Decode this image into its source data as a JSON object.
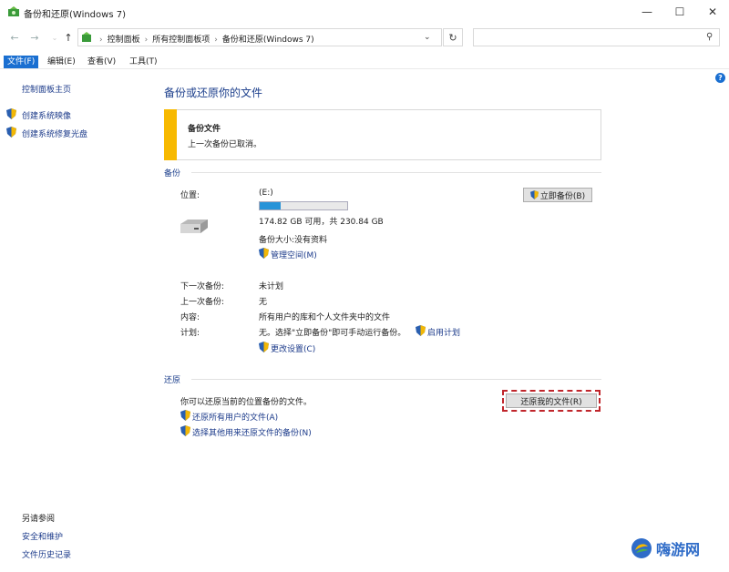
{
  "window": {
    "title": "备份和还原(Windows 7)",
    "controls": {
      "minimize": "—",
      "maximize": "☐",
      "close": "✕"
    }
  },
  "nav": {
    "back": "←",
    "forward": "→",
    "up": "↑",
    "breadcrumbs": [
      "控制面板",
      "所有控制面板项",
      "备份和还原(Windows 7)"
    ],
    "search_placeholder": ""
  },
  "menu": {
    "items": [
      "文件(F)",
      "编辑(E)",
      "查看(V)",
      "工具(T)"
    ],
    "help": "?"
  },
  "sidebar": {
    "home": "控制面板主页",
    "items": [
      "创建系统映像",
      "创建系统修复光盘"
    ],
    "see_also": {
      "title": "另请参阅",
      "items": [
        "安全和维护",
        "文件历史记录"
      ]
    }
  },
  "main": {
    "heading": "备份或还原你的文件",
    "notice": {
      "title": "备份文件",
      "text": "上一次备份已取消。",
      "accent": "#f7b900"
    },
    "backup": {
      "section": "备份",
      "location_label": "位置:",
      "drive_label": "(E:)",
      "used_fraction": 0.24,
      "space": "174.82 GB 可用，共 230.84 GB",
      "size_text": "备份大小:没有资料",
      "manage_space": "管理空间(M)",
      "backup_now": "立即备份(B)",
      "rows": [
        {
          "label": "下一次备份:",
          "value": "未计划"
        },
        {
          "label": "上一次备份:",
          "value": "无"
        },
        {
          "label": "内容:",
          "value": "所有用户的库和个人文件夹中的文件"
        },
        {
          "label": "计划:",
          "value": "无。选择\"立即备份\"即可手动运行备份。"
        }
      ],
      "enable_schedule": "启用计划",
      "change_settings": "更改设置(C)"
    },
    "restore": {
      "section": "还原",
      "text": "你可以还原当前的位置备份的文件。",
      "restore_button": "还原我的文件(R)",
      "links": [
        "还原所有用户的文件(A)",
        "选择其他用来还原文件的备份(N)"
      ]
    }
  },
  "watermark": {
    "text": "嗨游网"
  },
  "colors": {
    "link": "#1b3a8a",
    "heading": "#1c3f8c",
    "menu_active": "#1a6fd1",
    "progress": "#2793d8",
    "highlight": "#c0252b"
  }
}
